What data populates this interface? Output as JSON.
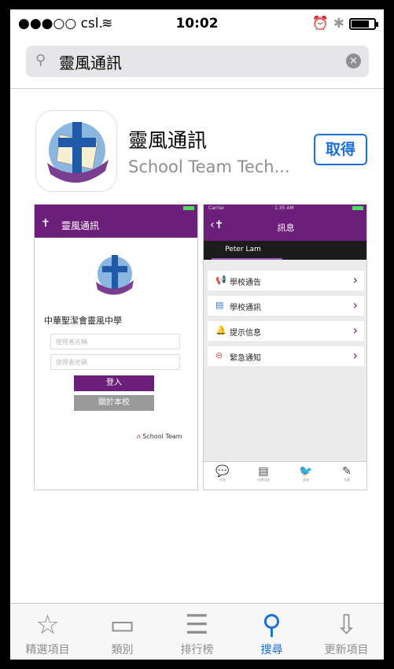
{
  "status": {
    "carrier": "●●●○○ csl.",
    "time": "10:02"
  },
  "search": {
    "query": "靈風通訊"
  },
  "app": {
    "name": "靈風通訊",
    "developer": "School Team Tech...",
    "get_label": "取得"
  },
  "screenshot1": {
    "header_title": "靈風通訊",
    "school_name": "中華聖潔會靈風中學",
    "username_placeholder": "使用者名稱",
    "password_placeholder": "使用者密碼",
    "login_label": "登入",
    "about_label": "關於本校",
    "brand": "School Team"
  },
  "screenshot2": {
    "carrier": "Carrier",
    "time": "1:35 AM",
    "header_title": "訊息",
    "user_tab": "Peter Lam",
    "rows": [
      {
        "icon": "📢",
        "label": "學校通告"
      },
      {
        "icon": "▤",
        "label": "學校通訊"
      },
      {
        "icon": "🔔",
        "label": "提示信息"
      },
      {
        "icon": "⊖",
        "label": "緊急通知"
      }
    ],
    "bottom": [
      {
        "icon": "💬",
        "cap": "訊息"
      },
      {
        "icon": "▤",
        "cap": "出席紀錄"
      },
      {
        "icon": "🐦",
        "cap": "訓育"
      },
      {
        "icon": "✎",
        "cap": "功課"
      }
    ]
  },
  "tabs": [
    {
      "label": "精選項目",
      "icon": "☆"
    },
    {
      "label": "類別",
      "icon": "▭"
    },
    {
      "label": "排行榜",
      "icon": "☰"
    },
    {
      "label": "搜尋",
      "icon": "⚲"
    },
    {
      "label": "更新項目",
      "icon": "⇩"
    }
  ],
  "colors": {
    "accent": "#1a6fd8",
    "app_purple": "#6c1f7a"
  }
}
